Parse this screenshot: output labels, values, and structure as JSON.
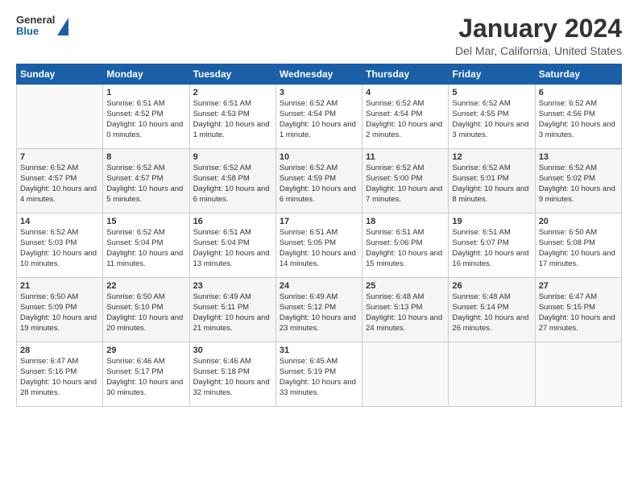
{
  "logo": {
    "general": "General",
    "blue": "Blue"
  },
  "title": "January 2024",
  "location": "Del Mar, California, United States",
  "days_header": [
    "Sunday",
    "Monday",
    "Tuesday",
    "Wednesday",
    "Thursday",
    "Friday",
    "Saturday"
  ],
  "weeks": [
    [
      {
        "day": "",
        "sunrise": "",
        "sunset": "",
        "daylight": ""
      },
      {
        "day": "1",
        "sunrise": "Sunrise: 6:51 AM",
        "sunset": "Sunset: 4:52 PM",
        "daylight": "Daylight: 10 hours and 0 minutes."
      },
      {
        "day": "2",
        "sunrise": "Sunrise: 6:51 AM",
        "sunset": "Sunset: 4:53 PM",
        "daylight": "Daylight: 10 hours and 1 minute."
      },
      {
        "day": "3",
        "sunrise": "Sunrise: 6:52 AM",
        "sunset": "Sunset: 4:54 PM",
        "daylight": "Daylight: 10 hours and 1 minute."
      },
      {
        "day": "4",
        "sunrise": "Sunrise: 6:52 AM",
        "sunset": "Sunset: 4:54 PM",
        "daylight": "Daylight: 10 hours and 2 minutes."
      },
      {
        "day": "5",
        "sunrise": "Sunrise: 6:52 AM",
        "sunset": "Sunset: 4:55 PM",
        "daylight": "Daylight: 10 hours and 3 minutes."
      },
      {
        "day": "6",
        "sunrise": "Sunrise: 6:52 AM",
        "sunset": "Sunset: 4:56 PM",
        "daylight": "Daylight: 10 hours and 3 minutes."
      }
    ],
    [
      {
        "day": "7",
        "sunrise": "Sunrise: 6:52 AM",
        "sunset": "Sunset: 4:57 PM",
        "daylight": "Daylight: 10 hours and 4 minutes."
      },
      {
        "day": "8",
        "sunrise": "Sunrise: 6:52 AM",
        "sunset": "Sunset: 4:57 PM",
        "daylight": "Daylight: 10 hours and 5 minutes."
      },
      {
        "day": "9",
        "sunrise": "Sunrise: 6:52 AM",
        "sunset": "Sunset: 4:58 PM",
        "daylight": "Daylight: 10 hours and 6 minutes."
      },
      {
        "day": "10",
        "sunrise": "Sunrise: 6:52 AM",
        "sunset": "Sunset: 4:59 PM",
        "daylight": "Daylight: 10 hours and 6 minutes."
      },
      {
        "day": "11",
        "sunrise": "Sunrise: 6:52 AM",
        "sunset": "Sunset: 5:00 PM",
        "daylight": "Daylight: 10 hours and 7 minutes."
      },
      {
        "day": "12",
        "sunrise": "Sunrise: 6:52 AM",
        "sunset": "Sunset: 5:01 PM",
        "daylight": "Daylight: 10 hours and 8 minutes."
      },
      {
        "day": "13",
        "sunrise": "Sunrise: 6:52 AM",
        "sunset": "Sunset: 5:02 PM",
        "daylight": "Daylight: 10 hours and 9 minutes."
      }
    ],
    [
      {
        "day": "14",
        "sunrise": "Sunrise: 6:52 AM",
        "sunset": "Sunset: 5:03 PM",
        "daylight": "Daylight: 10 hours and 10 minutes."
      },
      {
        "day": "15",
        "sunrise": "Sunrise: 6:52 AM",
        "sunset": "Sunset: 5:04 PM",
        "daylight": "Daylight: 10 hours and 11 minutes."
      },
      {
        "day": "16",
        "sunrise": "Sunrise: 6:51 AM",
        "sunset": "Sunset: 5:04 PM",
        "daylight": "Daylight: 10 hours and 13 minutes."
      },
      {
        "day": "17",
        "sunrise": "Sunrise: 6:51 AM",
        "sunset": "Sunset: 5:05 PM",
        "daylight": "Daylight: 10 hours and 14 minutes."
      },
      {
        "day": "18",
        "sunrise": "Sunrise: 6:51 AM",
        "sunset": "Sunset: 5:06 PM",
        "daylight": "Daylight: 10 hours and 15 minutes."
      },
      {
        "day": "19",
        "sunrise": "Sunrise: 6:51 AM",
        "sunset": "Sunset: 5:07 PM",
        "daylight": "Daylight: 10 hours and 16 minutes."
      },
      {
        "day": "20",
        "sunrise": "Sunrise: 6:50 AM",
        "sunset": "Sunset: 5:08 PM",
        "daylight": "Daylight: 10 hours and 17 minutes."
      }
    ],
    [
      {
        "day": "21",
        "sunrise": "Sunrise: 6:50 AM",
        "sunset": "Sunset: 5:09 PM",
        "daylight": "Daylight: 10 hours and 19 minutes."
      },
      {
        "day": "22",
        "sunrise": "Sunrise: 6:50 AM",
        "sunset": "Sunset: 5:10 PM",
        "daylight": "Daylight: 10 hours and 20 minutes."
      },
      {
        "day": "23",
        "sunrise": "Sunrise: 6:49 AM",
        "sunset": "Sunset: 5:11 PM",
        "daylight": "Daylight: 10 hours and 21 minutes."
      },
      {
        "day": "24",
        "sunrise": "Sunrise: 6:49 AM",
        "sunset": "Sunset: 5:12 PM",
        "daylight": "Daylight: 10 hours and 23 minutes."
      },
      {
        "day": "25",
        "sunrise": "Sunrise: 6:48 AM",
        "sunset": "Sunset: 5:13 PM",
        "daylight": "Daylight: 10 hours and 24 minutes."
      },
      {
        "day": "26",
        "sunrise": "Sunrise: 6:48 AM",
        "sunset": "Sunset: 5:14 PM",
        "daylight": "Daylight: 10 hours and 26 minutes."
      },
      {
        "day": "27",
        "sunrise": "Sunrise: 6:47 AM",
        "sunset": "Sunset: 5:15 PM",
        "daylight": "Daylight: 10 hours and 27 minutes."
      }
    ],
    [
      {
        "day": "28",
        "sunrise": "Sunrise: 6:47 AM",
        "sunset": "Sunset: 5:16 PM",
        "daylight": "Daylight: 10 hours and 28 minutes."
      },
      {
        "day": "29",
        "sunrise": "Sunrise: 6:46 AM",
        "sunset": "Sunset: 5:17 PM",
        "daylight": "Daylight: 10 hours and 30 minutes."
      },
      {
        "day": "30",
        "sunrise": "Sunrise: 6:46 AM",
        "sunset": "Sunset: 5:18 PM",
        "daylight": "Daylight: 10 hours and 32 minutes."
      },
      {
        "day": "31",
        "sunrise": "Sunrise: 6:45 AM",
        "sunset": "Sunset: 5:19 PM",
        "daylight": "Daylight: 10 hours and 33 minutes."
      },
      {
        "day": "",
        "sunrise": "",
        "sunset": "",
        "daylight": ""
      },
      {
        "day": "",
        "sunrise": "",
        "sunset": "",
        "daylight": ""
      },
      {
        "day": "",
        "sunrise": "",
        "sunset": "",
        "daylight": ""
      }
    ]
  ]
}
